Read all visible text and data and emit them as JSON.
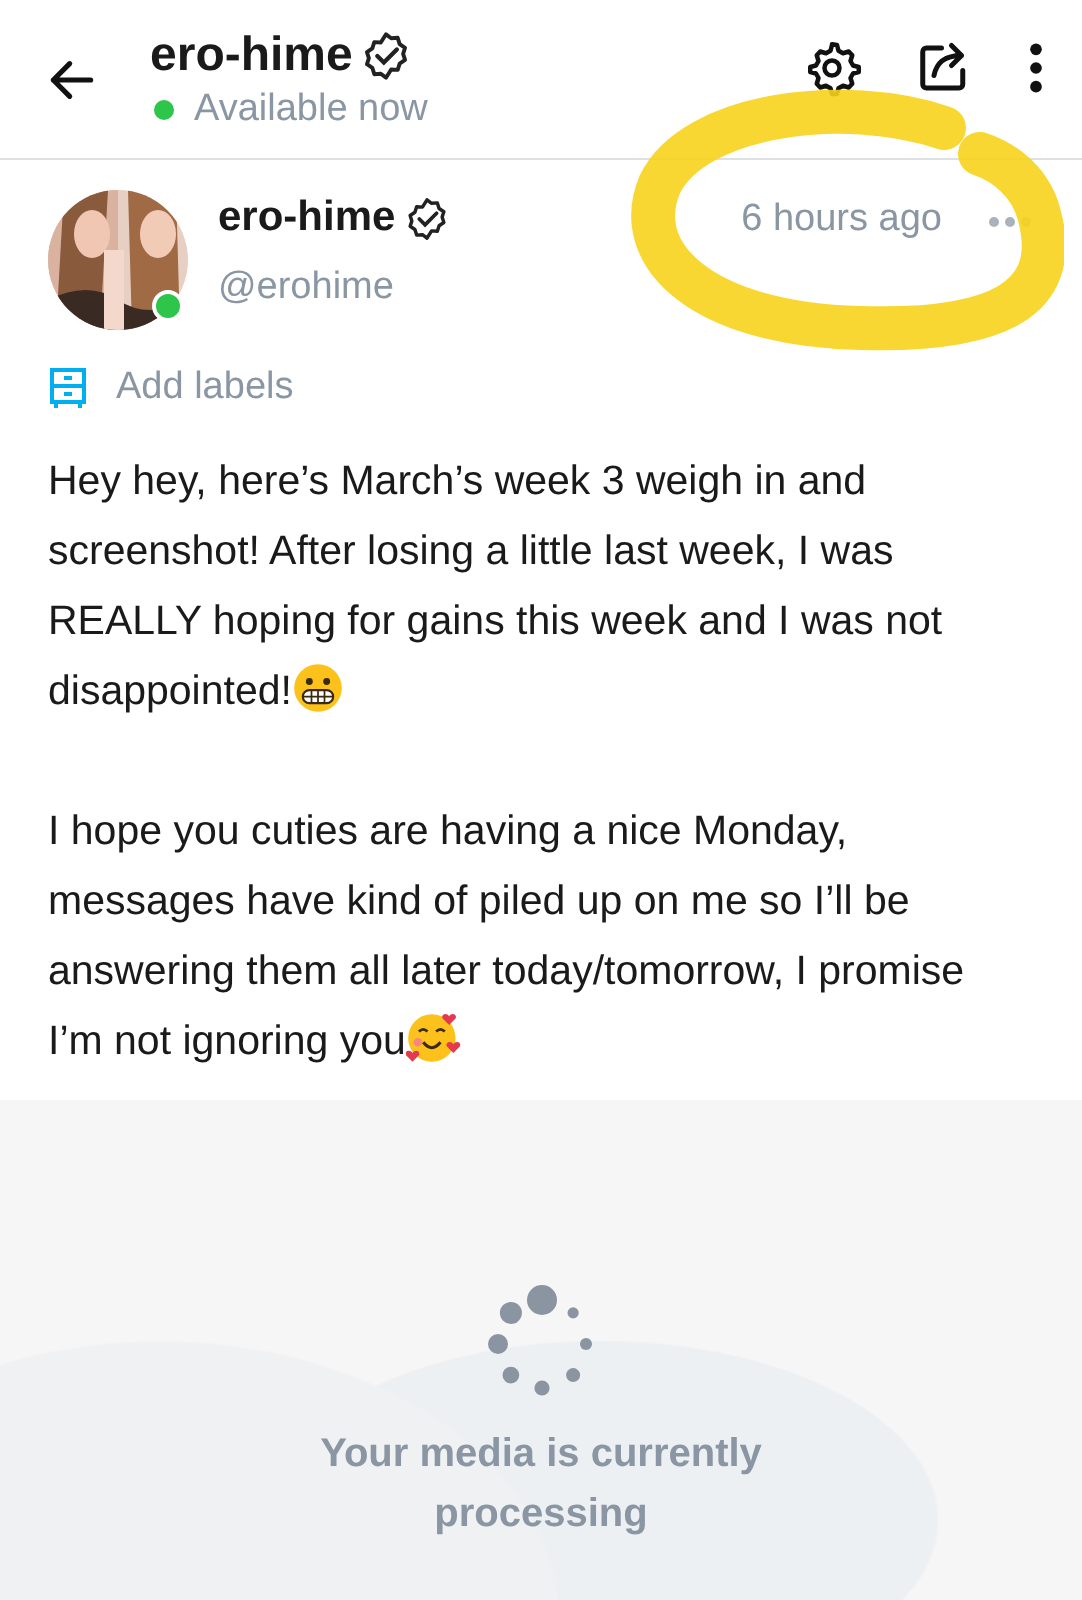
{
  "header": {
    "title": "ero-hime",
    "verified": true,
    "status": "Available now",
    "online": true
  },
  "post": {
    "author": "ero-hime",
    "verified": true,
    "handle": "@erohime",
    "online": true,
    "time": "6 hours ago",
    "labels_action": "Add labels",
    "paragraphs": [
      {
        "text": "Hey hey, here’s March’s week 3 weigh in and screenshot! After losing a little last week, I was REALLY hoping for gains this week and I was not disappointed!",
        "kind": "grimacing"
      },
      {
        "text": "I hope you cuties are having a nice Monday, messages have kind of piled up on me so I’ll be answering them all later today/tomorrow, I promise I’m not ignoring you",
        "kind": "hearts"
      }
    ],
    "media": {
      "message": "Your media is currently processing"
    }
  }
}
